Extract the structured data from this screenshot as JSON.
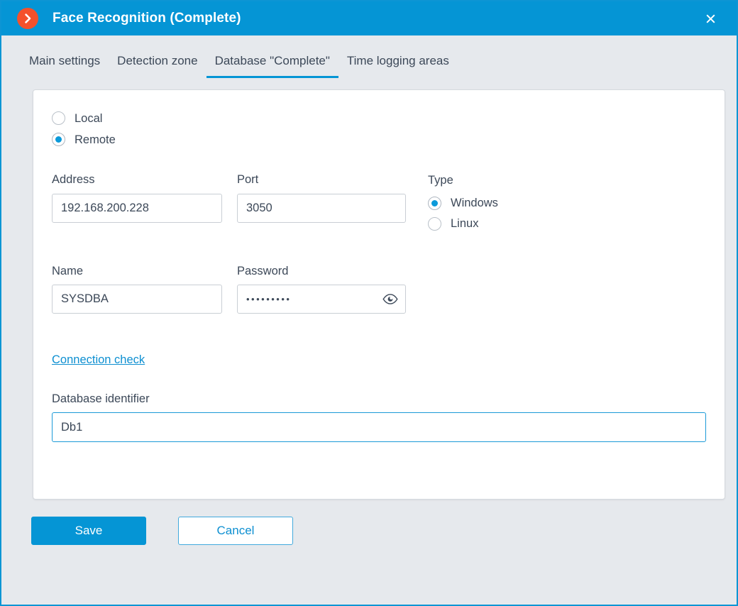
{
  "window": {
    "title": "Face Recognition (Complete)",
    "app_icon": "chevron-right-circle-icon",
    "close_icon": "close-icon",
    "accent_color": "#0595d5",
    "icon_color": "#f4512c",
    "page_bg": "#e6e9ed"
  },
  "tabs": [
    {
      "label": "Main settings",
      "active": false
    },
    {
      "label": "Detection zone",
      "active": false
    },
    {
      "label": "Database \"Complete\"",
      "active": true
    },
    {
      "label": "Time logging areas",
      "active": false
    }
  ],
  "form": {
    "mode": {
      "options": [
        {
          "label": "Local",
          "selected": false
        },
        {
          "label": "Remote",
          "selected": true
        }
      ]
    },
    "address": {
      "label": "Address",
      "value": "192.168.200.228"
    },
    "port": {
      "label": "Port",
      "value": "3050"
    },
    "type": {
      "label": "Type",
      "options": [
        {
          "label": "Windows",
          "selected": true
        },
        {
          "label": "Linux",
          "selected": false
        }
      ]
    },
    "name": {
      "label": "Name",
      "value": "SYSDBA"
    },
    "password": {
      "label": "Password",
      "value": "•••••••••",
      "reveal_icon": "eye-icon"
    },
    "connection_check": {
      "label": "Connection check"
    },
    "database_identifier": {
      "label": "Database identifier",
      "value": "Db1",
      "focused": true
    }
  },
  "footer": {
    "save_label": "Save",
    "cancel_label": "Cancel"
  }
}
